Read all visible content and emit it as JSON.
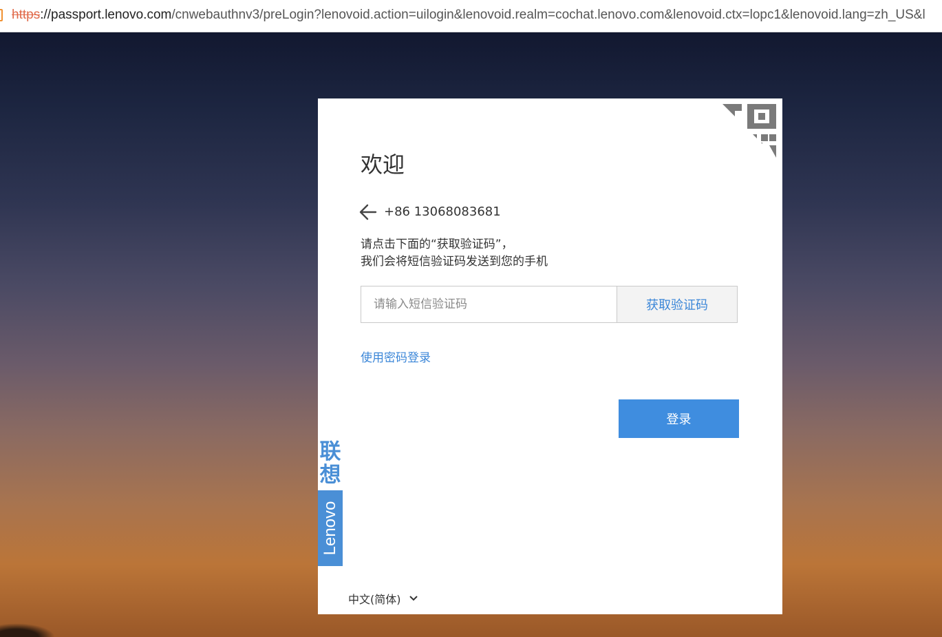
{
  "browser": {
    "url_scheme": "https",
    "url_host": "://passport.lenovo.com",
    "url_rest": "/cnwebauthnv3/preLogin?lenovoid.action=uilogin&lenovoid.realm=cochat.lenovo.com&lenovoid.ctx=lopc1&lenovoid.lang=zh_US&l"
  },
  "card": {
    "title": "欢迎",
    "phone": "+86 13068083681",
    "hint_line1": "请点击下面的“获取验证码”，",
    "hint_line2": "我们会将短信验证码发送到您的手机",
    "code_placeholder": "请输入短信验证码",
    "get_code_label": "获取验证码",
    "password_login_label": "使用密码登录",
    "login_label": "登录",
    "brand_cn_1": "联",
    "brand_cn_2": "想",
    "brand_en": "Lenovo",
    "language": "中文(简体)"
  },
  "colors": {
    "accent": "#3f8ddf",
    "link": "#3c87d8",
    "brand": "#4a8fd6"
  },
  "icons": {
    "qr": "qr-code-corner-icon",
    "back": "arrow-left-icon",
    "lang": "chevron-down-icon"
  }
}
